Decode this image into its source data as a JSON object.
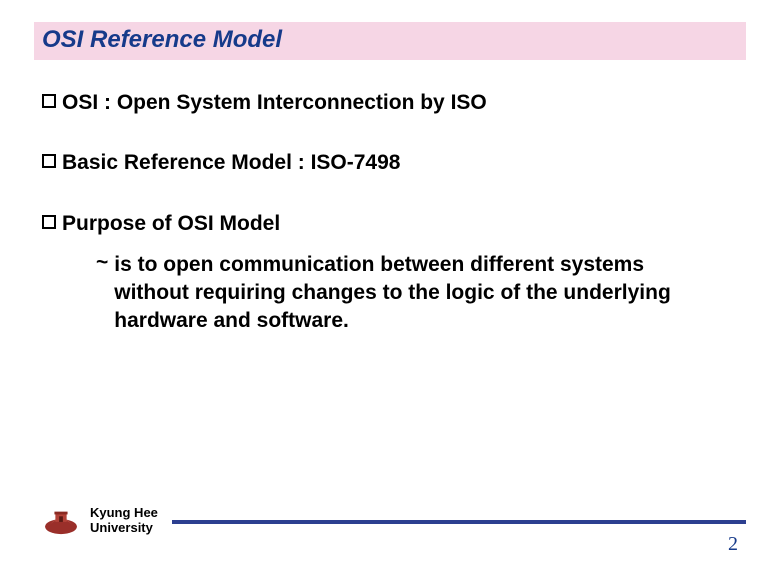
{
  "title": "OSI Reference Model",
  "bullets": {
    "b1": "OSI : Open System Interconnection by ISO",
    "b2": "Basic Reference Model : ISO-7498",
    "b3": "Purpose of OSI Model"
  },
  "purpose_detail": "is to open communication between different systems without requiring changes to the logic of the underlying hardware and software.",
  "footer": {
    "university_line1": "Kyung Hee",
    "university_line2": "University",
    "page_number": "2"
  },
  "colors": {
    "title_bg": "#f6d6e5",
    "title_text": "#163a8a",
    "footer_line": "#2c3f90"
  }
}
